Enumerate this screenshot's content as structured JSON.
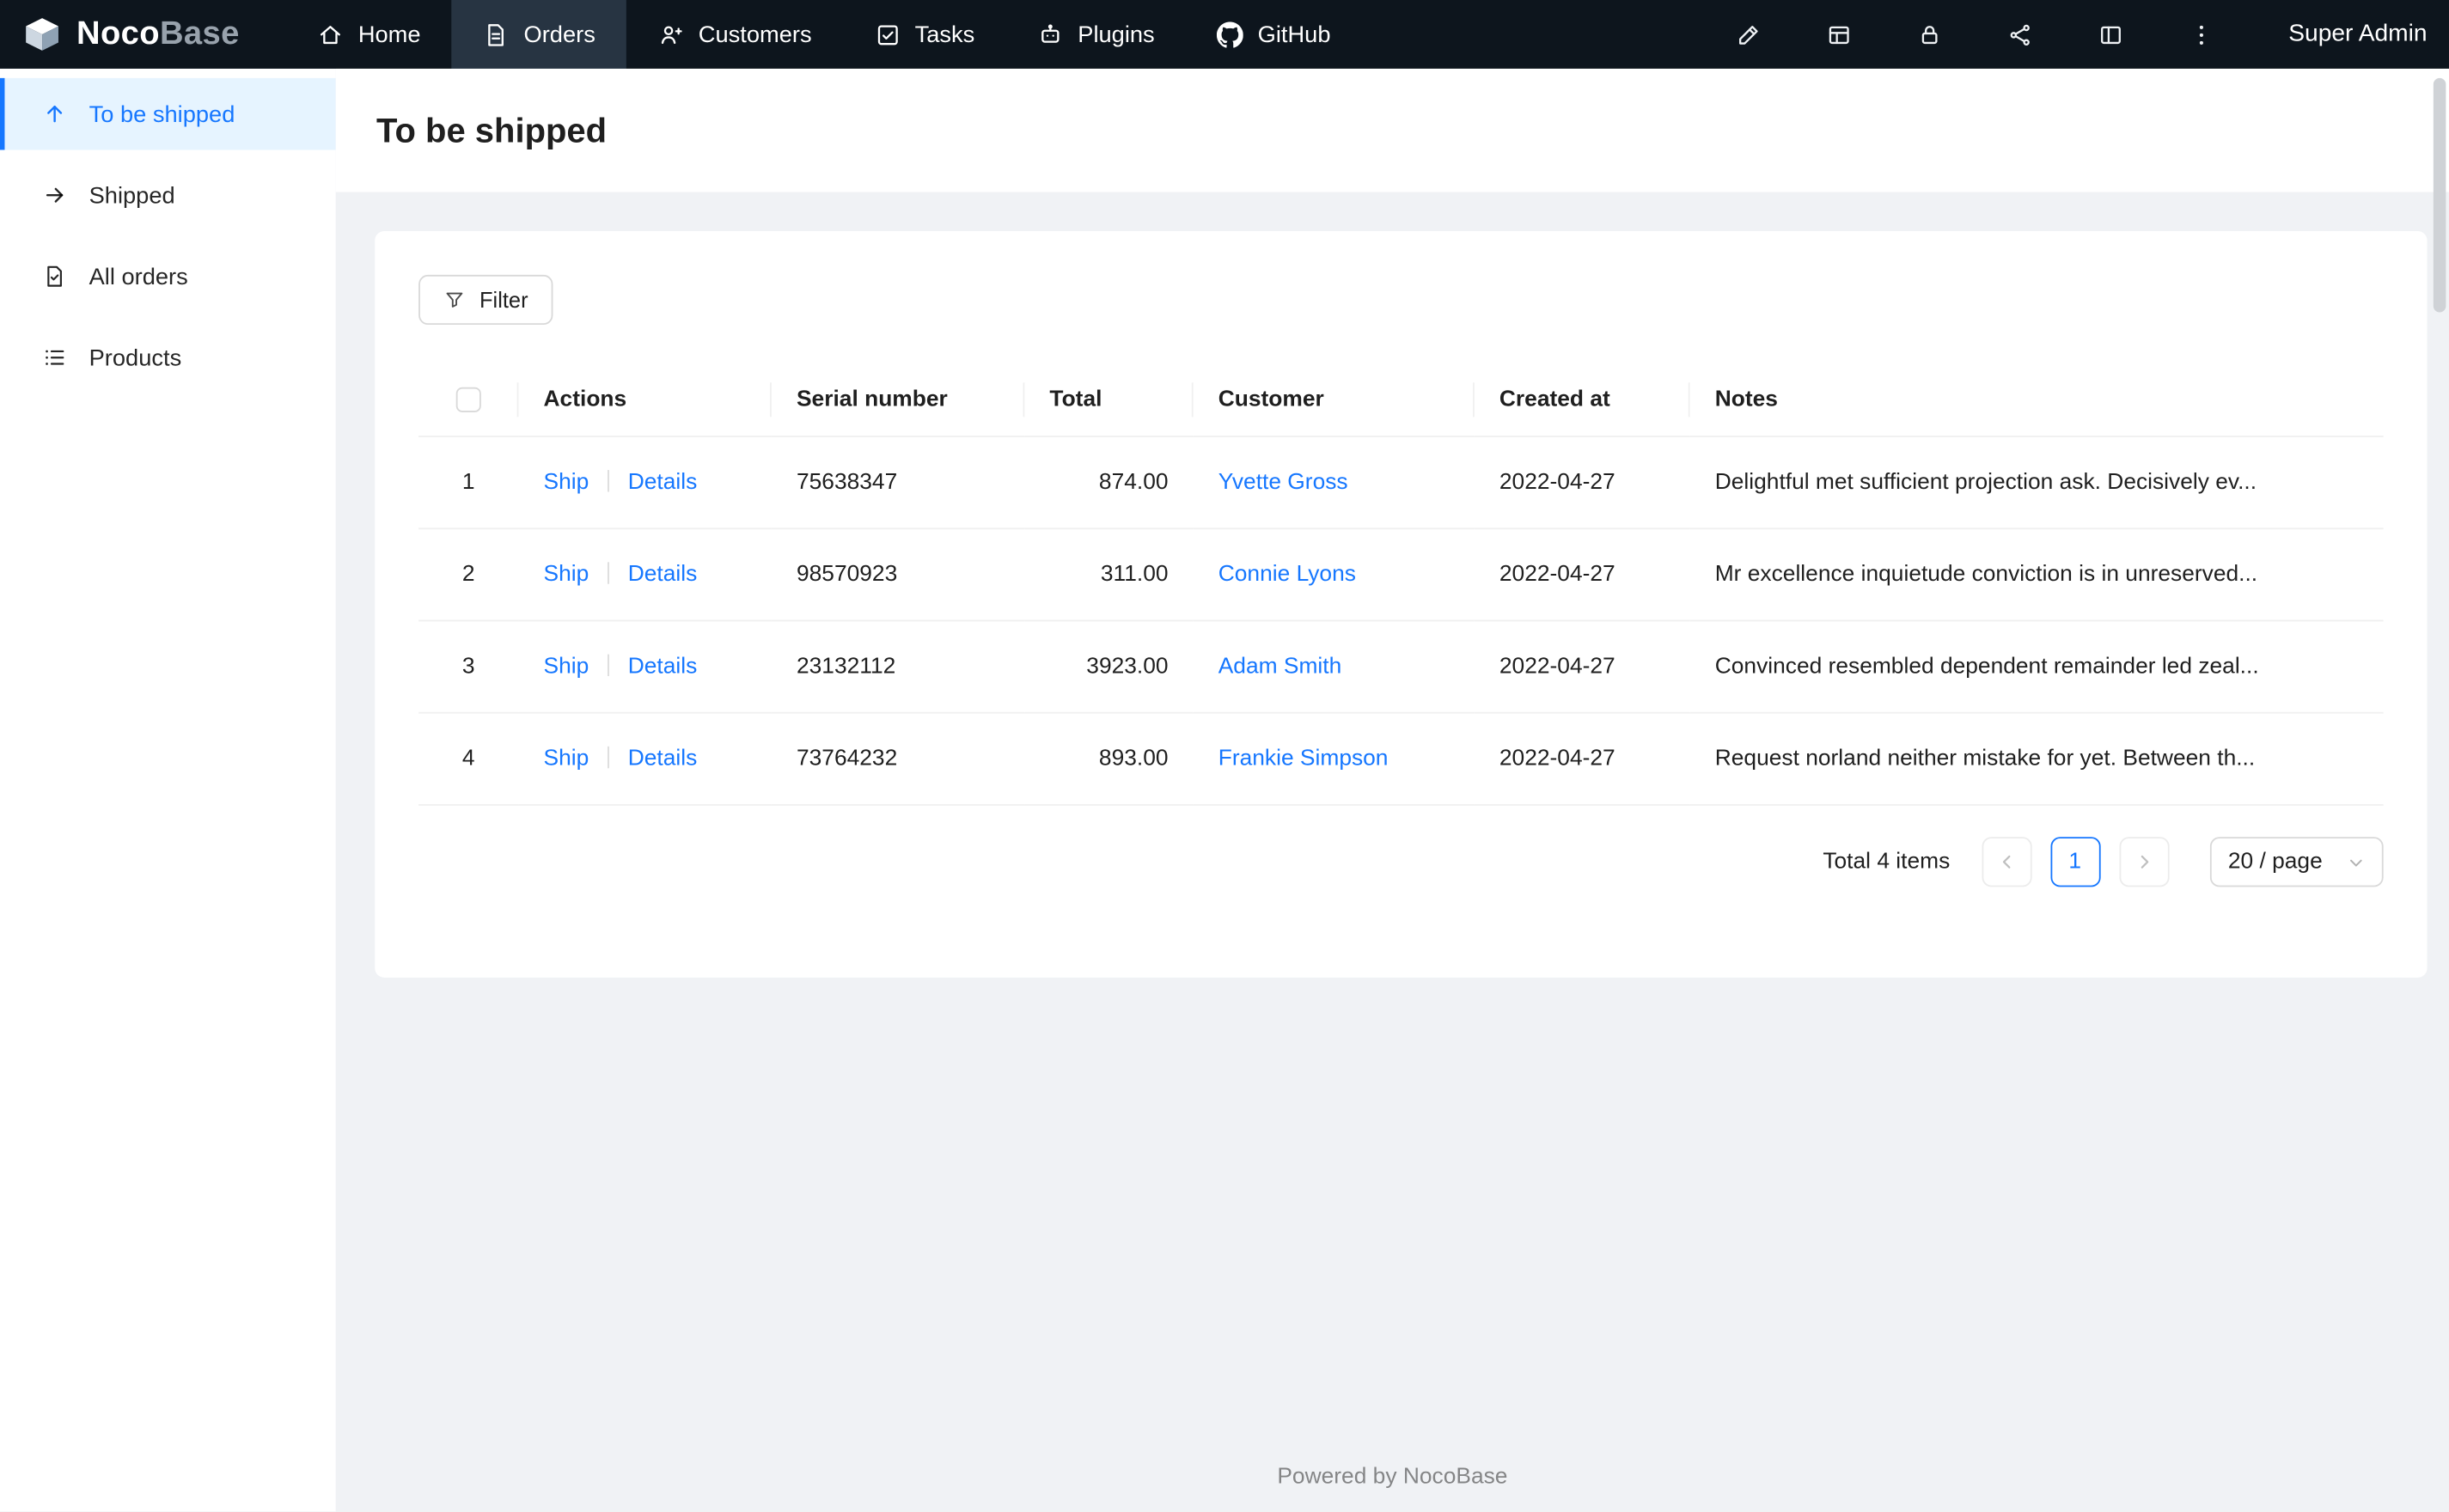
{
  "header": {
    "logo_primary": "Noco",
    "logo_secondary": "Base",
    "nav": [
      {
        "label": "Home",
        "icon": "home-icon",
        "active": false
      },
      {
        "label": "Orders",
        "icon": "orders-icon",
        "active": true
      },
      {
        "label": "Customers",
        "icon": "customers-icon",
        "active": false
      },
      {
        "label": "Tasks",
        "icon": "tasks-icon",
        "active": false
      },
      {
        "label": "Plugins",
        "icon": "plugins-icon",
        "active": false
      },
      {
        "label": "GitHub",
        "icon": "github-icon",
        "active": false
      }
    ],
    "action_icons": [
      "ui-editor-icon",
      "collections-icon",
      "lock-icon",
      "workflow-icon",
      "layout-icon",
      "more-icon"
    ],
    "user": "Super Admin"
  },
  "sidebar": {
    "items": [
      {
        "label": "To be shipped",
        "icon": "arrow-up-icon",
        "active": true
      },
      {
        "label": "Shipped",
        "icon": "arrow-right-icon",
        "active": false
      },
      {
        "label": "All orders",
        "icon": "order-file-icon",
        "active": false
      },
      {
        "label": "Products",
        "icon": "list-icon",
        "active": false
      }
    ]
  },
  "page": {
    "title": "To be shipped"
  },
  "toolbar": {
    "filter_label": "Filter"
  },
  "table": {
    "columns": [
      "Actions",
      "Serial number",
      "Total",
      "Customer",
      "Created at",
      "Notes"
    ],
    "rows": [
      {
        "index": "1",
        "actions": [
          "Ship",
          "Details"
        ],
        "serial": "75638347",
        "total": "874.00",
        "customer": "Yvette Gross",
        "created_at": "2022-04-27",
        "notes": "Delightful met sufficient projection ask. Decisively ev..."
      },
      {
        "index": "2",
        "actions": [
          "Ship",
          "Details"
        ],
        "serial": "98570923",
        "total": "311.00",
        "customer": "Connie Lyons",
        "created_at": "2022-04-27",
        "notes": "Mr excellence inquietude conviction is in unreserved..."
      },
      {
        "index": "3",
        "actions": [
          "Ship",
          "Details"
        ],
        "serial": "23132112",
        "total": "3923.00",
        "customer": "Adam Smith",
        "created_at": "2022-04-27",
        "notes": "Convinced resembled dependent remainder led zeal..."
      },
      {
        "index": "4",
        "actions": [
          "Ship",
          "Details"
        ],
        "serial": "73764232",
        "total": "893.00",
        "customer": "Frankie Simpson",
        "created_at": "2022-04-27",
        "notes": "Request norland neither mistake for yet. Between th..."
      }
    ]
  },
  "pagination": {
    "total_label": "Total 4 items",
    "current_page": "1",
    "page_size_label": "20 / page"
  },
  "footer": {
    "text": "Powered by NocoBase"
  },
  "colors": {
    "accent": "#1677ff",
    "header_bg": "#0d151d",
    "active_tab_bg": "rgba(132,166,199,0.22)",
    "sidebar_active_bg": "#e6f4ff",
    "content_bg": "#f0f2f5",
    "table_border": "#f0f0f0"
  }
}
